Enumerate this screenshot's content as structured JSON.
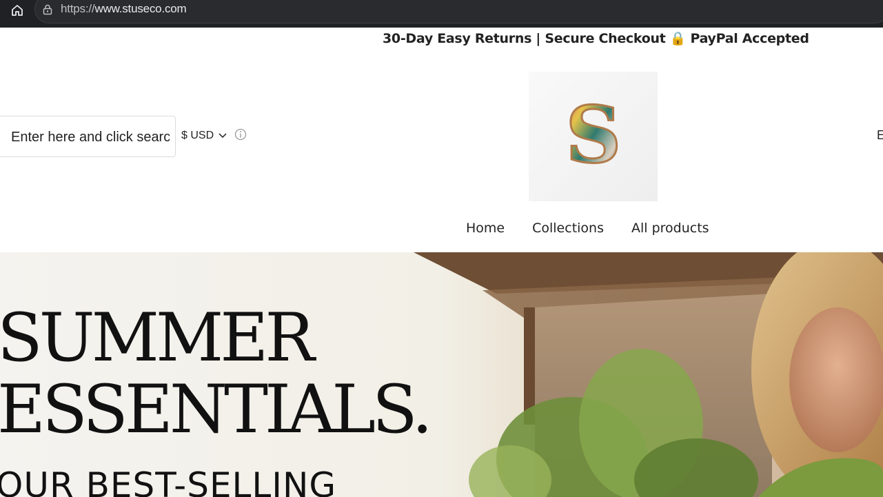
{
  "browser": {
    "url_scheme": "https://",
    "url_host": "www.stuseco.com"
  },
  "announcement": {
    "text": "30-Day Easy Returns | Secure Checkout 🔒 PayPal Accepted"
  },
  "header": {
    "search_placeholder": "Enter here and click search",
    "currency_label": "$ USD",
    "logo_letter": "S",
    "edge_text": "E"
  },
  "nav": {
    "items": [
      "Home",
      "Collections",
      "All products"
    ]
  },
  "hero": {
    "title_line1": "SUMMER",
    "title_line2": "ESSENTIALS.",
    "subtitle": "OUR BEST-SELLING"
  },
  "colors": {
    "browser_bg": "#202124",
    "text_primary": "#222222",
    "hero_text": "#111111"
  }
}
